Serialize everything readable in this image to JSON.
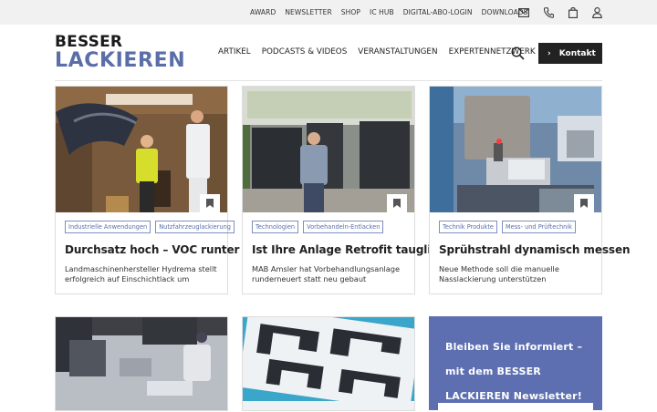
{
  "topbar": {
    "links": [
      "AWARD",
      "NEWSLETTER",
      "SHOP",
      "IC HUB",
      "DIGITAL-ABO-LOGIN",
      "DOWNLOADS"
    ],
    "icons": [
      "mail-icon",
      "phone-icon",
      "bag-icon",
      "user-icon"
    ]
  },
  "logo": {
    "line1": "BESSER",
    "line2": "LACKIEREN"
  },
  "nav": {
    "items": [
      "ARTIKEL",
      "PODCASTS & VIDEOS",
      "VERANSTALTUNGEN",
      "EXPERTENNETZWERK"
    ],
    "contact_label": "Kontakt"
  },
  "cards": [
    {
      "tags": [
        "Industrielle Anwendungen",
        "Nutzfahrzeuglackierung"
      ],
      "title": "Durchsatz hoch – VOC runter",
      "desc": "Landmaschinenhersteller Hydrema stellt erfolgreich auf Einschichtlack um"
    },
    {
      "tags": [
        "Technologien",
        "Vorbehandeln-Entlacken"
      ],
      "title": "Ist Ihre Anlage Retrofit tauglich?",
      "desc": "MAB Amsler hat Vorbehandlungsanlage runderneuert statt neu gebaut"
    },
    {
      "tags": [
        "Technik Produkte",
        "Mess- und Prüftechnik"
      ],
      "title": "Sprühstrahl dynamisch messen",
      "desc": "Neue Methode soll die manuelle Nasslackierung unterstützen"
    }
  ],
  "newsletter": {
    "text": "Bleiben Sie informiert – mit dem BESSER LACKIEREN Newsletter!"
  },
  "colors": {
    "brand": "#5a6ea8",
    "newsletter_bg": "#5d6fb0",
    "contact_bg": "#222222",
    "topbar_bg": "#f1f1f1"
  }
}
